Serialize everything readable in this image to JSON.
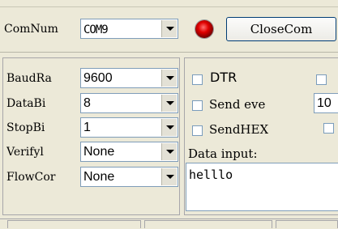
{
  "top": {
    "com_label": "ComNum",
    "com_value": "COM9",
    "close_button": "CloseCom"
  },
  "settings": [
    {
      "label": "BaudRa",
      "value": "9600"
    },
    {
      "label": "DataBi",
      "value": "8"
    },
    {
      "label": "StopBi",
      "value": "1"
    },
    {
      "label": "Verifyl",
      "value": "None"
    },
    {
      "label": "FlowCor",
      "value": "None"
    }
  ],
  "options": {
    "dtr_label": "DTR",
    "send_every_label": "Send eve",
    "send_every_value": "10",
    "send_hex_label": "SendHEX",
    "data_input_label": "Data input:",
    "data_input_value": "helllo"
  },
  "colors": {
    "background": "#ece9d8",
    "indicator": "#d40000"
  }
}
